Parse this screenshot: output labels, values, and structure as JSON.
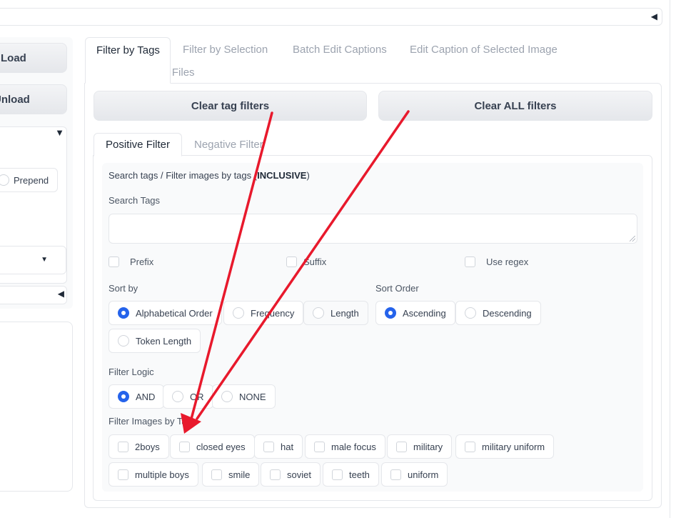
{
  "left": {
    "load_label": "Load",
    "unload_label": "Unload",
    "prepend_label": "Prepend"
  },
  "tabs": [
    {
      "label": "Filter by Tags"
    },
    {
      "label": "Filter by Selection"
    },
    {
      "label": "Batch Edit Captions"
    },
    {
      "label": "Edit Caption of Selected Image"
    },
    {
      "label": "Move or Delete Files"
    }
  ],
  "actions": {
    "clear_tag_filters": "Clear tag filters",
    "clear_all_filters": "Clear ALL filters"
  },
  "subtabs": [
    {
      "label": "Positive Filter"
    },
    {
      "label": "Negative Filter"
    }
  ],
  "filter": {
    "heading_prefix": "Search tags / Filter images by tags (",
    "heading_bold": "INCLUSIVE",
    "heading_suffix": ")",
    "search_label": "Search Tags",
    "search_value": "",
    "options": [
      {
        "label": "Prefix",
        "checked": false
      },
      {
        "label": "Suffix",
        "checked": false
      },
      {
        "label": "Use regex",
        "checked": false
      }
    ],
    "sort_by_label": "Sort by",
    "sort_by": [
      {
        "label": "Alphabetical Order",
        "selected": true
      },
      {
        "label": "Frequency",
        "selected": false
      },
      {
        "label": "Length",
        "selected": false
      },
      {
        "label": "Token Length",
        "selected": false
      }
    ],
    "sort_order_label": "Sort Order",
    "sort_order": [
      {
        "label": "Ascending",
        "selected": true
      },
      {
        "label": "Descending",
        "selected": false
      }
    ],
    "logic_label": "Filter Logic",
    "logic": [
      {
        "label": "AND",
        "selected": true
      },
      {
        "label": "OR",
        "selected": false
      },
      {
        "label": "NONE",
        "selected": false
      }
    ],
    "images_label": "Filter Images by Tags",
    "tags": [
      {
        "label": "2boys",
        "checked": false
      },
      {
        "label": "closed eyes",
        "checked": false
      },
      {
        "label": "hat",
        "checked": false
      },
      {
        "label": "male focus",
        "checked": false
      },
      {
        "label": "military",
        "checked": false
      },
      {
        "label": "military uniform",
        "checked": false
      },
      {
        "label": "multiple boys",
        "checked": false
      },
      {
        "label": "smile",
        "checked": false
      },
      {
        "label": "soviet",
        "checked": false
      },
      {
        "label": "teeth",
        "checked": false
      },
      {
        "label": "uniform",
        "checked": false
      }
    ]
  },
  "colors": {
    "accent": "#2563eb",
    "annotation_arrow": "#e8192c",
    "border": "#e5e7eb",
    "panel_bg": "#f9fafb"
  },
  "icons": {
    "collapse": "triangle-left-icon",
    "expand": "triangle-down-icon",
    "dropdown": "caret-down-icon",
    "annotation": "red-arrow-annotation"
  }
}
